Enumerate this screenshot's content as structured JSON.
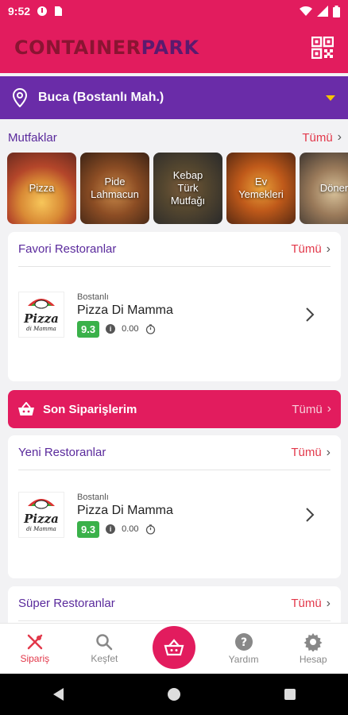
{
  "status": {
    "time": "9:52"
  },
  "header": {
    "brand_part1": "CONTAINER",
    "brand_part2": "PARK"
  },
  "location": {
    "text": "Buca  (Bostanlı Mah.)"
  },
  "kitchens": {
    "title": "Mutfaklar",
    "all_label": "Tümü",
    "items": [
      {
        "label": "Pizza"
      },
      {
        "label": "Pide\nLahmacun"
      },
      {
        "label": "Kebap\nTürk\nMutfağı"
      },
      {
        "label": "Ev\nYemekleri"
      },
      {
        "label": "Döner"
      }
    ]
  },
  "favorites": {
    "title": "Favori Restoranlar",
    "all_label": "Tümü",
    "restaurant": {
      "district": "Bostanlı",
      "name": "Pizza Di Mamma",
      "score": "9.3",
      "min_order": "0.00",
      "logo_text": "Pizza",
      "logo_sub": "di Mamma"
    }
  },
  "recent_orders": {
    "title": "Son Siparişlerim",
    "all_label": "Tümü"
  },
  "new_restaurants": {
    "title": "Yeni Restoranlar",
    "all_label": "Tümü",
    "restaurant": {
      "district": "Bostanlı",
      "name": "Pizza Di Mamma",
      "score": "9.3",
      "min_order": "0.00",
      "logo_text": "Pizza",
      "logo_sub": "di Mamma"
    }
  },
  "super_restaurants": {
    "title": "Süper Restoranlar",
    "all_label": "Tümü"
  },
  "bottom_nav": {
    "order": "Sipariş",
    "explore": "Keşfet",
    "help": "Yardım",
    "account": "Hesap"
  },
  "colors": {
    "primary": "#e21c5e",
    "purple": "#6a2ca8",
    "score_green": "#3ab14a",
    "accent_red": "#e2384a"
  }
}
